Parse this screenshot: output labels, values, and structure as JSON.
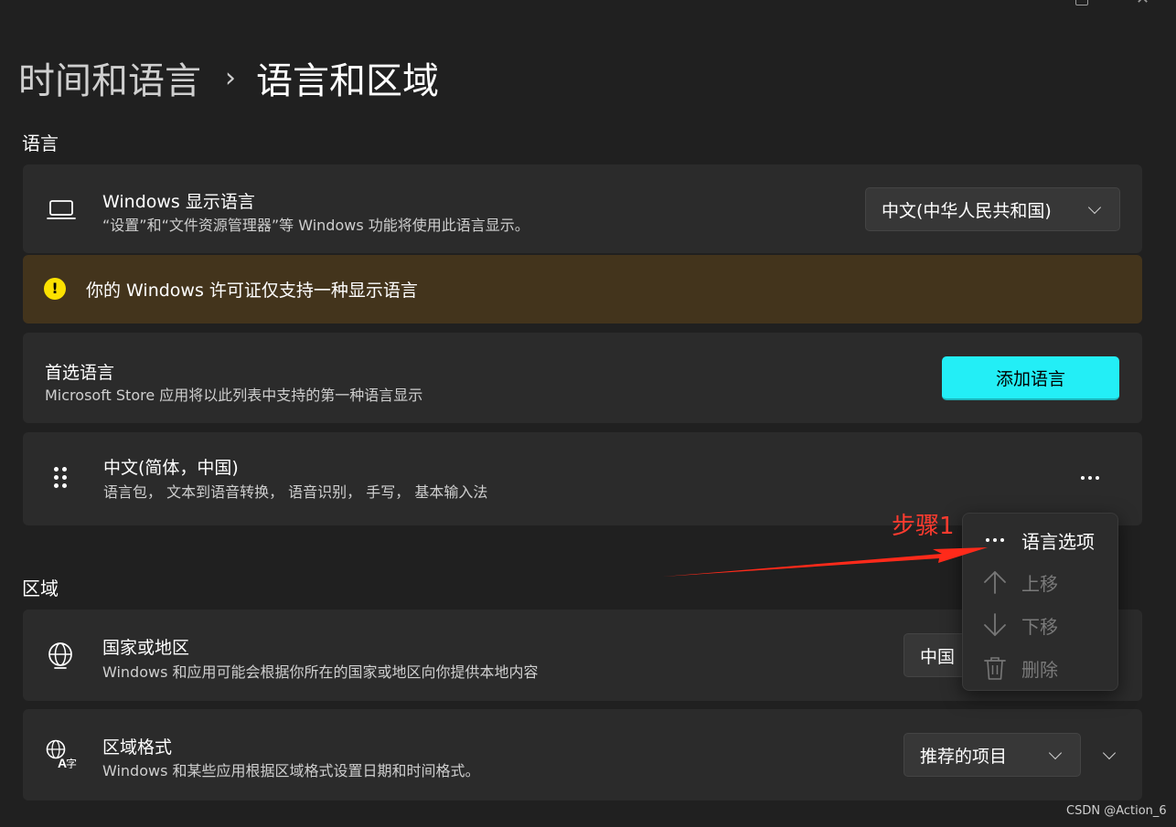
{
  "header": {
    "parent": "时间和语言",
    "separator": "›",
    "current": "语言和区域"
  },
  "language_section": {
    "title": "语言",
    "display_language": {
      "icon": "laptop-icon",
      "title": "Windows 显示语言",
      "subtitle": "“设置”和“文件资源管理器”等 Windows 功能将使用此语言显示。",
      "dropdown_value": "中文(中华人民共和国)"
    },
    "license_warning": {
      "icon": "warning-icon",
      "icon_glyph": "!",
      "text": "你的 Windows 许可证仅支持一种显示语言"
    },
    "preferred": {
      "title": "首选语言",
      "subtitle": "Microsoft Store 应用将以此列表中支持的第一种语言显示",
      "add_button": "添加语言"
    },
    "language_item": {
      "title": "中文(简体，中国)",
      "subtitle": "语言包， 文本到语音转换， 语音识别， 手写， 基本输入法"
    }
  },
  "context_menu": {
    "items": [
      {
        "icon": "more-icon",
        "label": "语言选项",
        "enabled": true
      },
      {
        "icon": "arrow-up-icon",
        "label": "上移",
        "enabled": false
      },
      {
        "icon": "arrow-down-icon",
        "label": "下移",
        "enabled": false
      },
      {
        "icon": "trash-icon",
        "label": "删除",
        "enabled": false
      }
    ]
  },
  "annotation": {
    "text": "步骤1",
    "color": "#ff3b2f"
  },
  "region_section": {
    "title": "区域",
    "country": {
      "icon": "globe-icon",
      "title": "国家或地区",
      "subtitle": "Windows 和应用可能会根据你所在的国家或地区向你提供本地内容",
      "dropdown_value": "中国"
    },
    "format": {
      "icon": "language-globe-icon",
      "title": "区域格式",
      "subtitle": "Windows 和某些应用根据区域格式设置日期和时间格式。",
      "dropdown_value": "推荐的项目"
    }
  },
  "watermark": "CSDN @Action_6",
  "colors": {
    "background": "#202020",
    "card": "#2b2b2b",
    "warning_bg": "#43341c",
    "warning_icon": "#fce100",
    "accent_button": "#23eef6",
    "annotation": "#ff3b2f"
  }
}
